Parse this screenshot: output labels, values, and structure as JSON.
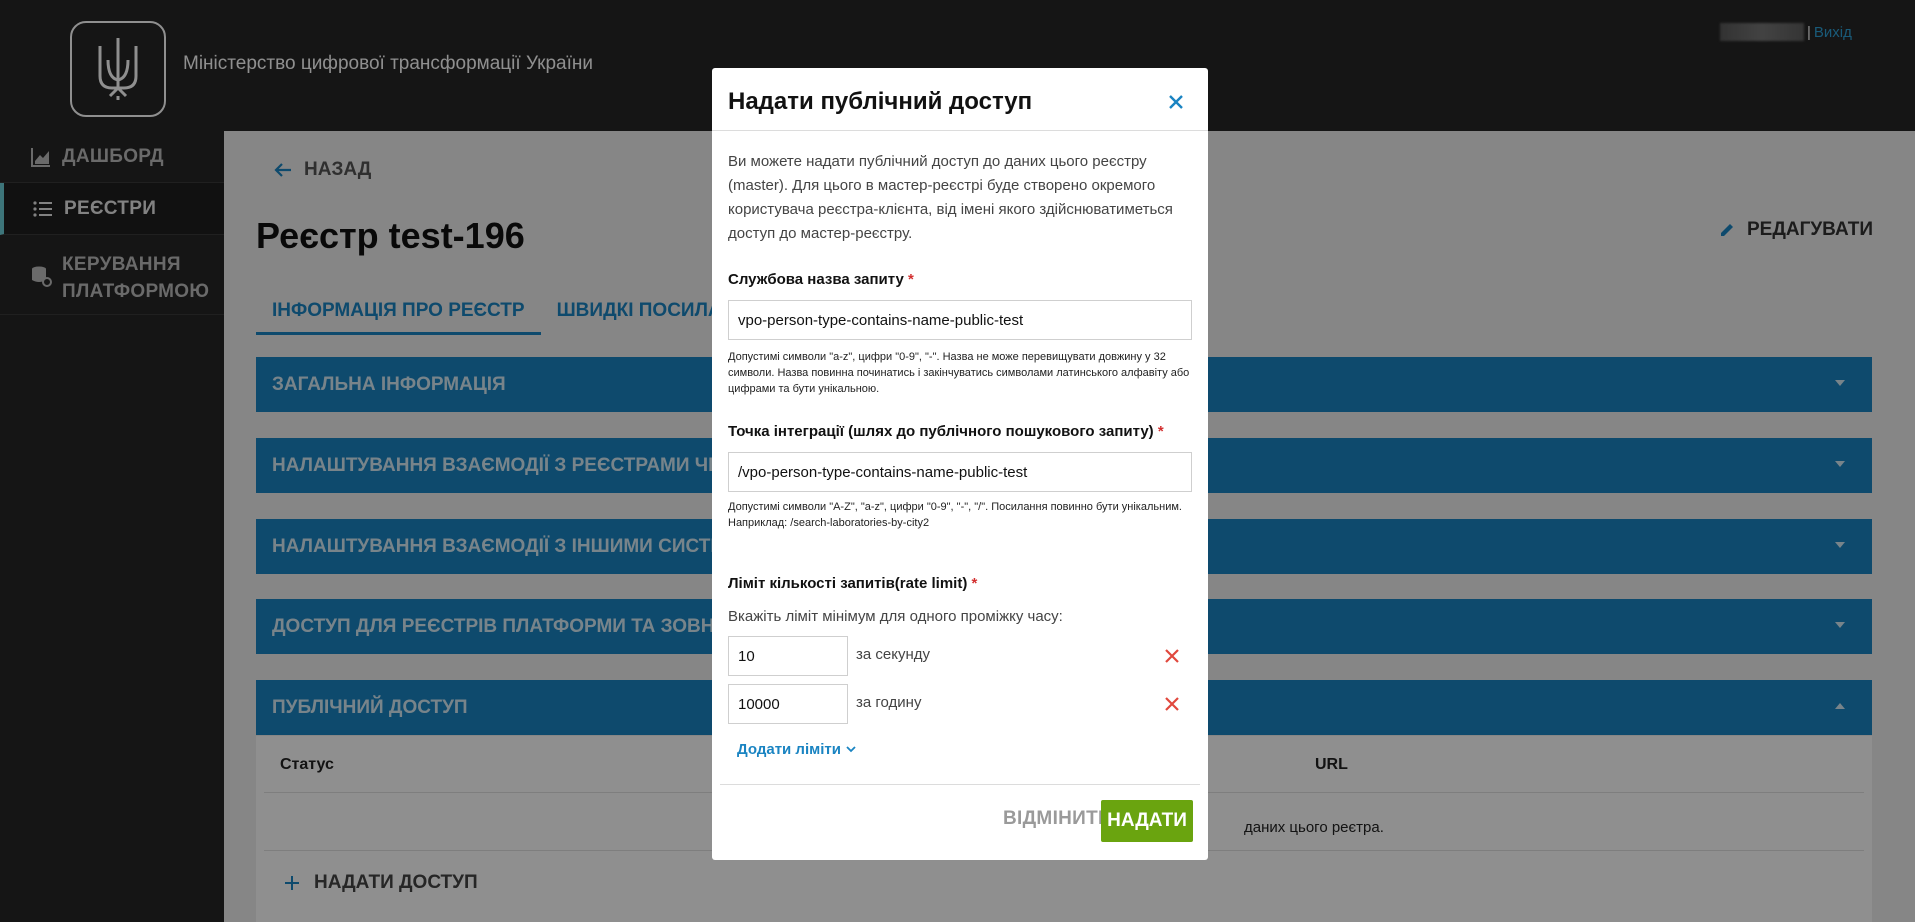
{
  "header": {
    "ministry": "Міністерство цифрової трансформації України",
    "logout": "Вихід"
  },
  "sidebar": {
    "items": [
      {
        "label": "ДАШБОРД",
        "icon": "chart-icon"
      },
      {
        "label": "РЕЄСТРИ",
        "icon": "list-icon"
      },
      {
        "label_line1": "КЕРУВАННЯ",
        "label_line2": "ПЛАТФОРМОЮ",
        "icon": "database-gear-icon"
      }
    ]
  },
  "main": {
    "back": "НАЗАД",
    "title": "Реєстр test-196",
    "edit": "РЕДАГУВАТИ",
    "tabs": [
      "ІНФОРМАЦІЯ ПРО РЕЄСТР",
      "ШВИДКІ ПОСИЛАННЯ"
    ],
    "panels": [
      "ЗАГАЛЬНА ІНФОРМАЦІЯ",
      "НАЛАШТУВАННЯ ВЗАЄМОДІЇ З РЕЄСТРАМИ ЧЕРЕЗ ТРЕМБІТУ",
      "НАЛАШТУВАННЯ ВЗАЄМОДІЇ З ІНШИМИ СИСТЕМАМИ",
      "ДОСТУП ДЛЯ РЕЄСТРІВ ПЛАТФОРМИ ТА ЗОВНІШНІХ СИСТЕМ",
      "ПУБЛІЧНИЙ ДОСТУП"
    ],
    "table": {
      "col_status": "Статус",
      "col_url": "URL",
      "empty_fragment": "даних цього реєтра."
    },
    "grant": "НАДАТИ ДОСТУП"
  },
  "modal": {
    "title": "Надати публічний доступ",
    "description": "Ви можете надати публічний доступ до даних цього реєстру (master). Для цього в мастер-реєстрі буде створено окремого користувача реєстра-клієнта, від імені якого здійснюватиметься доступ до мастер-реєстру.",
    "service_name": {
      "label": "Службова назва запиту",
      "value": "vpo-person-type-contains-name-public-test",
      "hint": "Допустимі символи \"a-z\", цифри \"0-9\", \"-\". Назва не може перевищувати довжину у 32 символи. Назва повинна починатись і закінчуватись символами латинського алфавіту або цифрами та бути унікальною."
    },
    "integration_point": {
      "label": "Точка інтеграції (шлях до публічного пошукового запиту)",
      "value": "/vpo-person-type-contains-name-public-test",
      "hint_line1": "Допустимі символи \"A-Z\", \"a-z\", цифри \"0-9\", \"-\", \"/\". Посилання повинно бути унікальним.",
      "hint_line2": "Наприклад: /search-laboratories-by-city2"
    },
    "rate_limit": {
      "label": "Ліміт кількості запитів(rate limit)",
      "sub": "Вкажіть ліміт мінімум для одного проміжку часу:",
      "limits": [
        {
          "value": "10",
          "unit": "за секунду"
        },
        {
          "value": "10000",
          "unit": "за годину"
        }
      ],
      "add": "Додати ліміти"
    },
    "cancel": "ВІДМІНИТИ",
    "submit": "НАДАТИ",
    "required_mark": "*"
  }
}
